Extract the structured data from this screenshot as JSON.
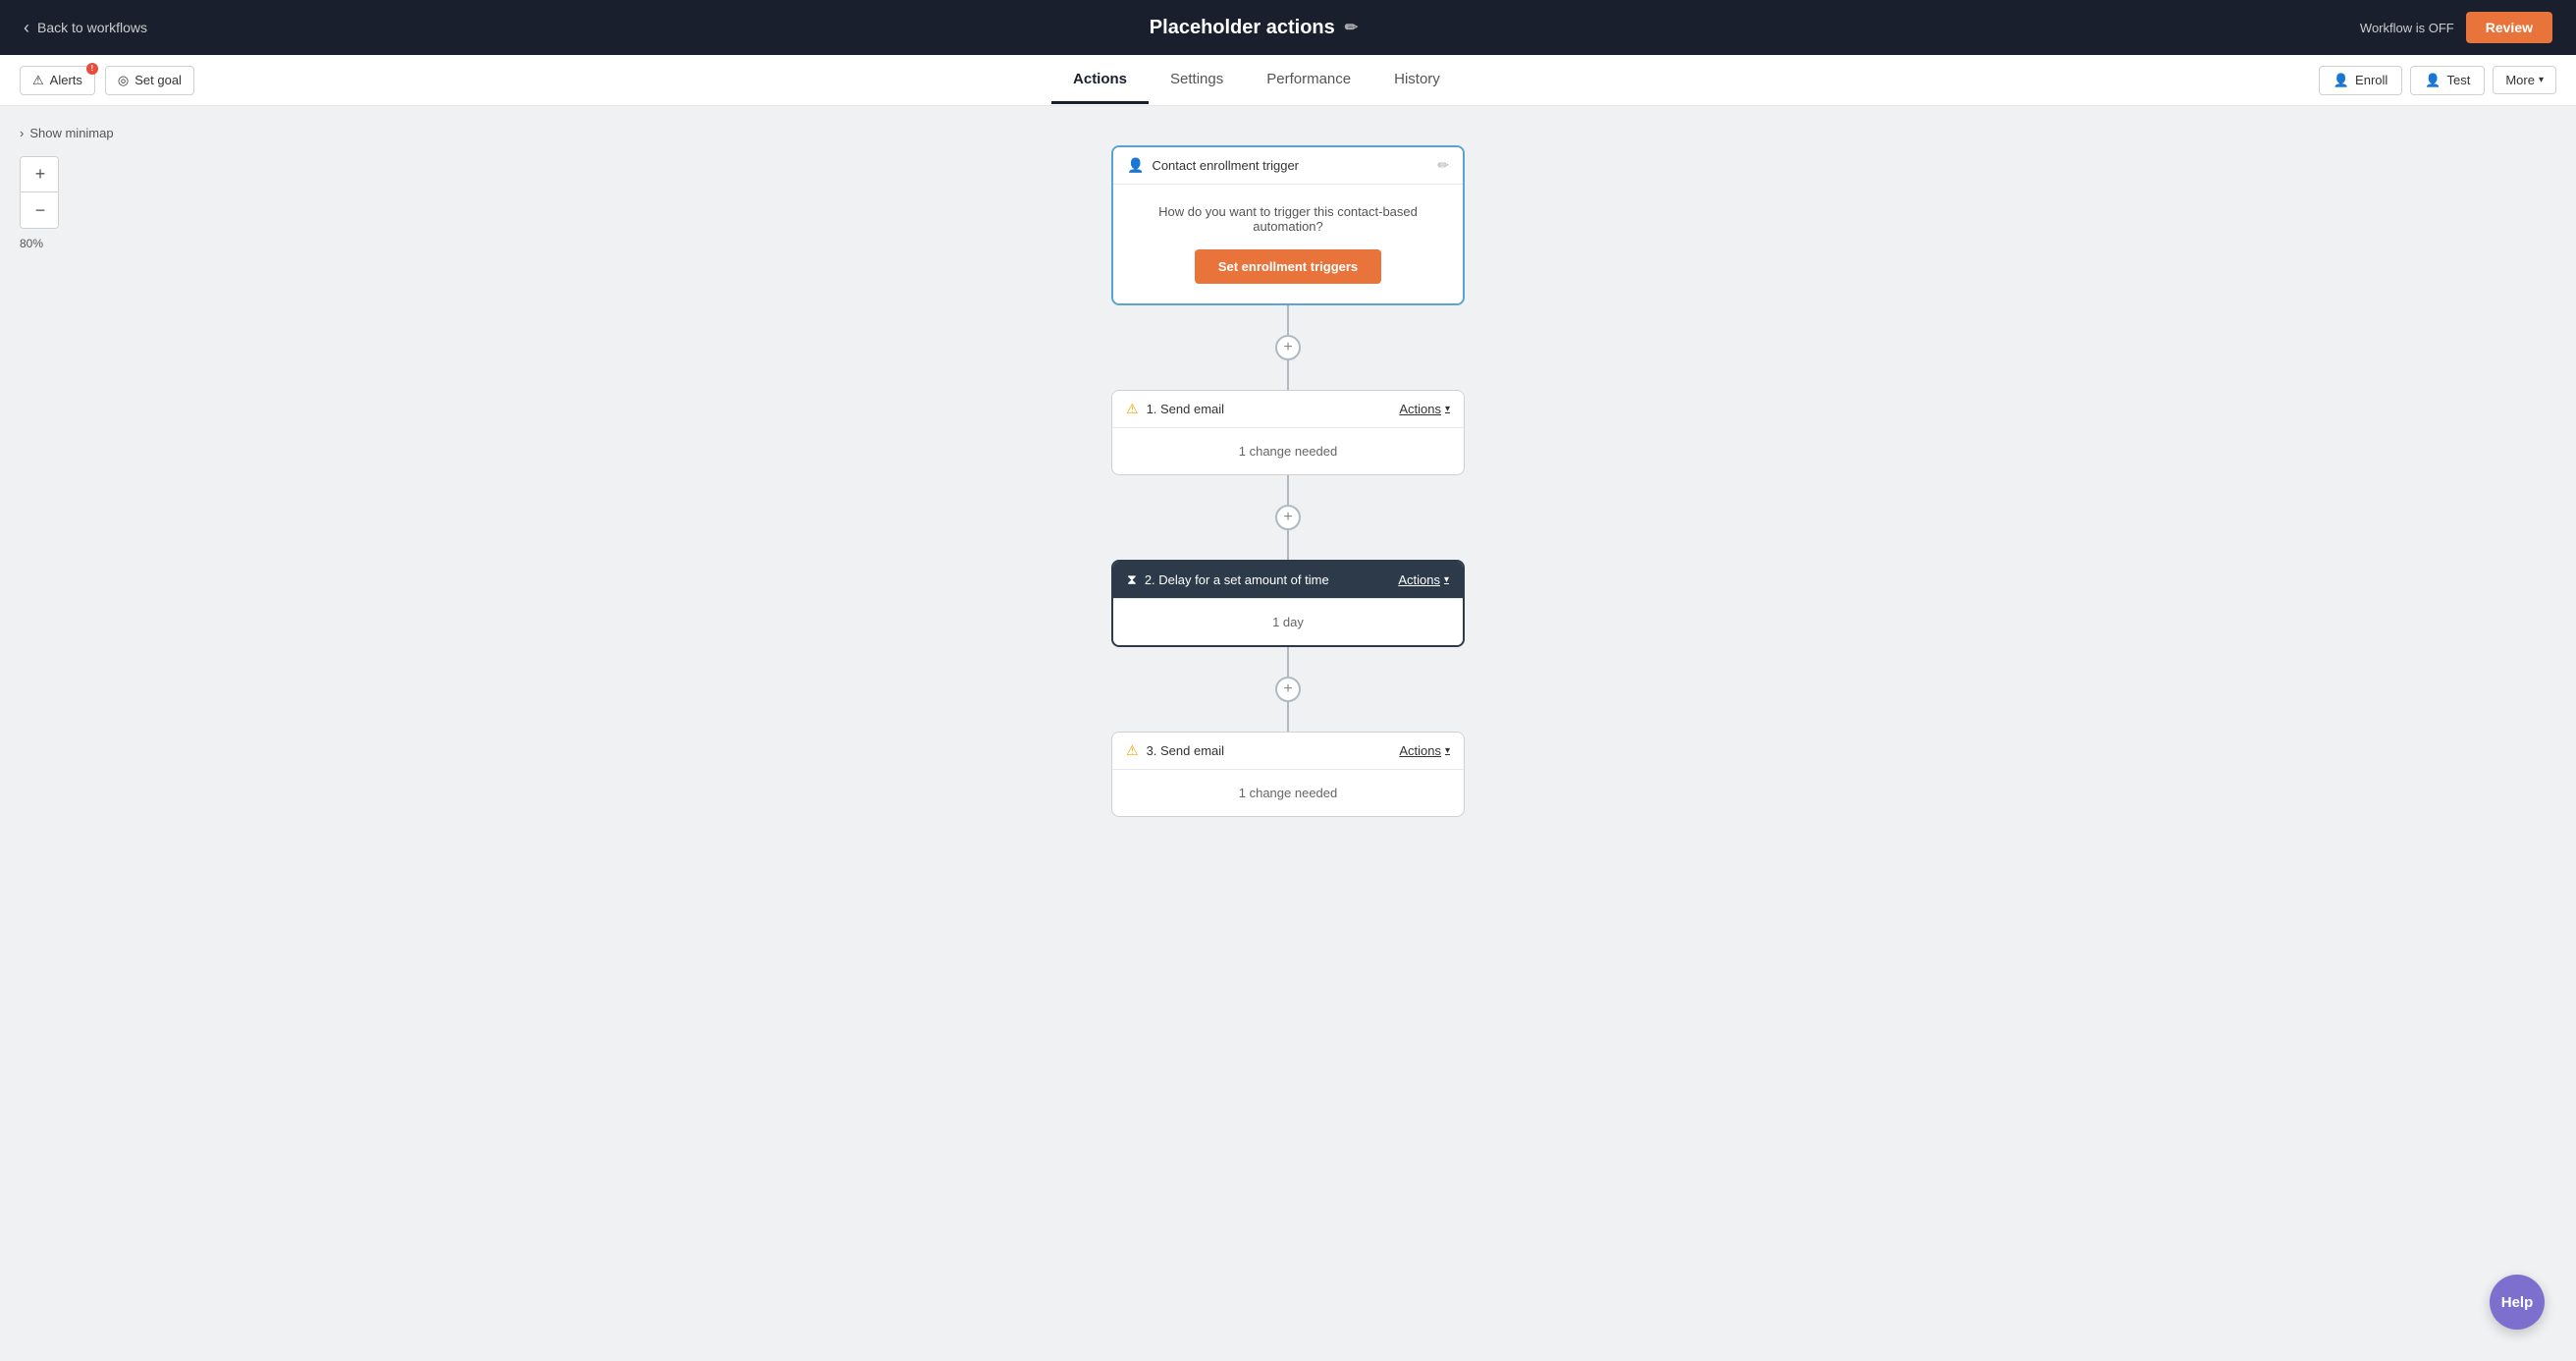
{
  "topBar": {
    "backLabel": "Back to workflows",
    "title": "Placeholder actions",
    "editIconLabel": "✏",
    "workflowStatus": "Workflow is OFF",
    "reviewLabel": "Review"
  },
  "secondaryNav": {
    "alertsLabel": "Alerts",
    "setGoalLabel": "Set goal",
    "tabs": [
      {
        "id": "actions",
        "label": "Actions",
        "active": true
      },
      {
        "id": "settings",
        "label": "Settings",
        "active": false
      },
      {
        "id": "performance",
        "label": "Performance",
        "active": false
      },
      {
        "id": "history",
        "label": "History",
        "active": false
      }
    ],
    "enrollLabel": "Enroll",
    "testLabel": "Test",
    "moreLabel": "More"
  },
  "canvas": {
    "showMinimapLabel": "Show minimap",
    "zoomInLabel": "+",
    "zoomOutLabel": "−",
    "zoomLevel": "80%"
  },
  "trigger": {
    "icon": "👤",
    "headerLabel": "Contact enrollment trigger",
    "bodyText": "How do you want to trigger this contact-based automation?",
    "buttonLabel": "Set enrollment triggers"
  },
  "actions": [
    {
      "id": "1",
      "type": "email",
      "icon": "⚠",
      "label": "1. Send email",
      "actionsLabel": "Actions",
      "bodyText": "1 change needed",
      "isDark": false
    },
    {
      "id": "2",
      "type": "delay",
      "icon": "⧗",
      "label": "2. Delay for a set amount of time",
      "actionsLabel": "Actions",
      "bodyText": "1 day",
      "isDark": true
    },
    {
      "id": "3",
      "type": "email",
      "icon": "⚠",
      "label": "3. Send email",
      "actionsLabel": "Actions",
      "bodyText": "1 change needed",
      "isDark": false
    }
  ],
  "helpButton": {
    "label": "Help"
  }
}
